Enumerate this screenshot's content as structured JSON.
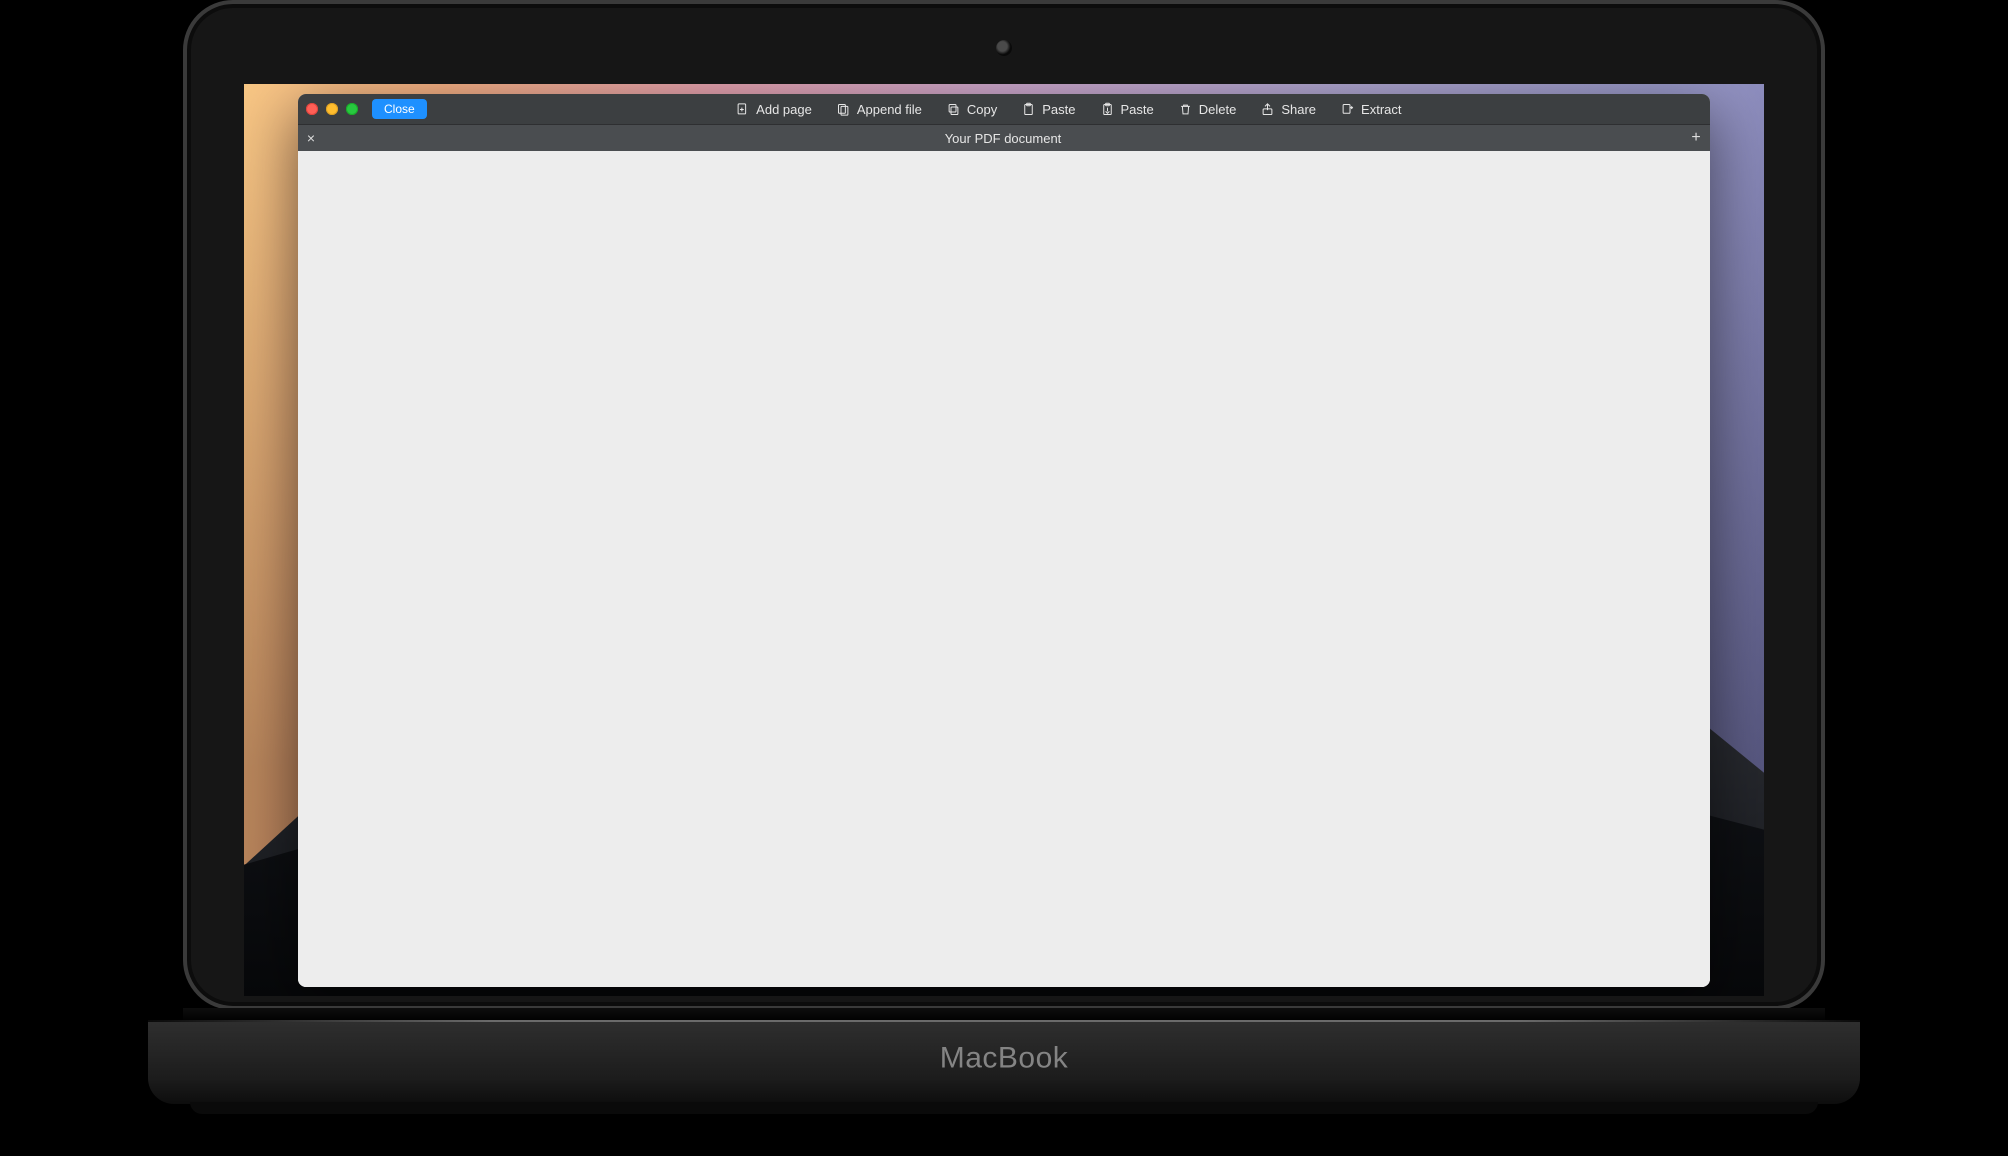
{
  "laptop": {
    "brand": "MacBook"
  },
  "toolbar": {
    "close_label": "Close",
    "items": [
      {
        "id": "add-page",
        "label": "Add page",
        "icon": "add-page-icon"
      },
      {
        "id": "append-file",
        "label": "Append file",
        "icon": "append-file-icon"
      },
      {
        "id": "copy",
        "label": "Copy",
        "icon": "copy-icon"
      },
      {
        "id": "paste",
        "label": "Paste",
        "icon": "paste-icon"
      },
      {
        "id": "paste-alt",
        "label": "Paste",
        "icon": "paste-alt-icon"
      },
      {
        "id": "delete",
        "label": "Delete",
        "icon": "trash-icon"
      },
      {
        "id": "share",
        "label": "Share",
        "icon": "share-icon"
      },
      {
        "id": "extract",
        "label": "Extract",
        "icon": "extract-icon"
      }
    ]
  },
  "tab": {
    "title": "Your PDF document",
    "close_glyph": "×",
    "add_glyph": "+"
  }
}
